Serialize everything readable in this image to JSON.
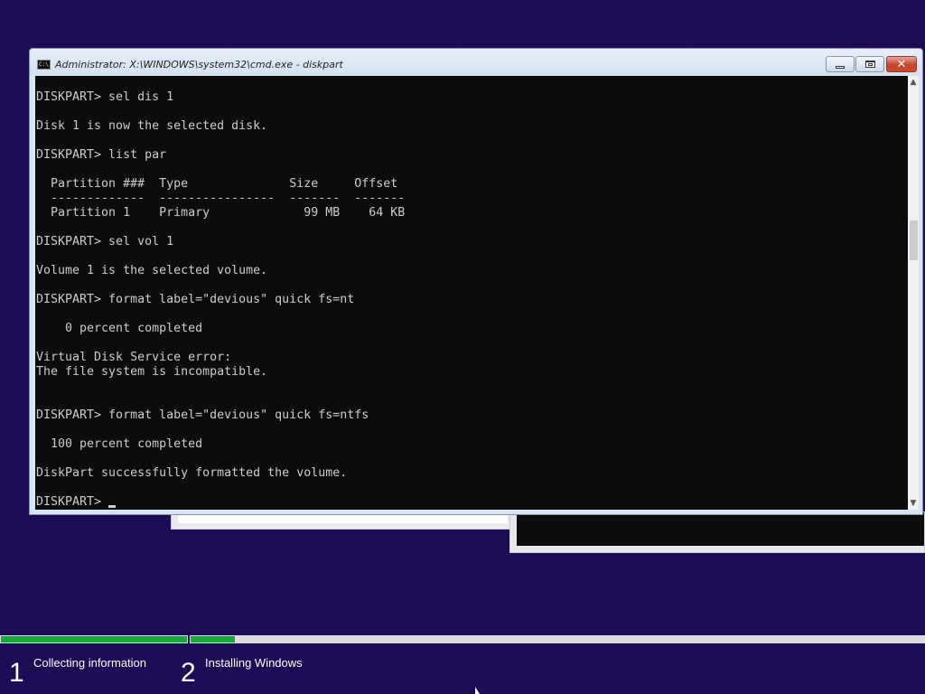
{
  "window": {
    "title": "Administrator: X:\\WINDOWS\\system32\\cmd.exe - diskpart",
    "icon": "cmd-icon",
    "icon_text": "C:\\",
    "buttons": {
      "minimize": "minimize-icon",
      "maximize": "restore-icon",
      "close": "close-icon"
    },
    "close_glyph": "✕"
  },
  "console": {
    "lines": [
      "DISKPART> sel dis 1",
      "",
      "Disk 1 is now the selected disk.",
      "",
      "DISKPART> list par",
      "",
      "  Partition ###  Type              Size     Offset",
      "  -------------  ----------------  -------  -------",
      "  Partition 1    Primary             99 MB    64 KB",
      "",
      "DISKPART> sel vol 1",
      "",
      "Volume 1 is the selected volume.",
      "",
      "DISKPART> format label=\"devious\" quick fs=nt",
      "",
      "    0 percent completed",
      "",
      "Virtual Disk Service error:",
      "The file system is incompatible.",
      "",
      "",
      "DISKPART> format label=\"devious\" quick fs=ntfs",
      "",
      "  100 percent completed",
      "",
      "DiskPart successfully formatted the volume.",
      ""
    ],
    "prompt": "DISKPART> ",
    "scroll_up": "▲",
    "scroll_down": "▼"
  },
  "setup": {
    "progress": {
      "step1_fraction": 1.0,
      "step2_fraction": 0.06
    },
    "steps": [
      {
        "number": "1",
        "label": "Collecting information"
      },
      {
        "number": "2",
        "label": "Installing Windows"
      }
    ]
  },
  "colors": {
    "desktop": "#1e0b55",
    "console_bg": "#0c0c0c",
    "console_fg": "#cccccc",
    "progress_fill": "#1aa63a"
  }
}
